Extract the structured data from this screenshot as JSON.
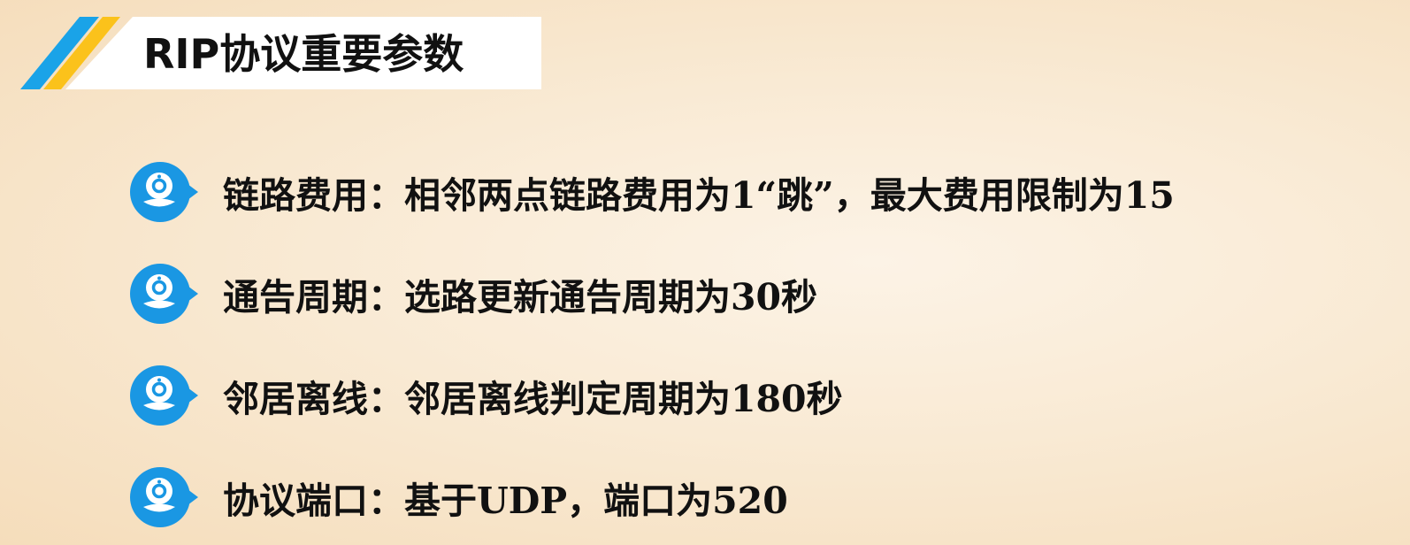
{
  "title": "RIP协议重要参数",
  "colors": {
    "stripe_blue": "#1aa3e8",
    "stripe_yellow": "#fbc21b",
    "bullet_blue": "#1a97e3",
    "text": "#111111"
  },
  "bullet_icon": "webcam-bullet-icon",
  "items": [
    {
      "label": "链路费用：",
      "text": "相邻两点链路费用为1“跳”，最大费用限制为15"
    },
    {
      "label": "通告周期：",
      "text": "选路更新通告周期为30秒"
    },
    {
      "label": "邻居离线：",
      "text": "邻居离线判定周期为180秒"
    },
    {
      "label": "协议端口：",
      "text": "基于UDP，端口为520"
    }
  ]
}
